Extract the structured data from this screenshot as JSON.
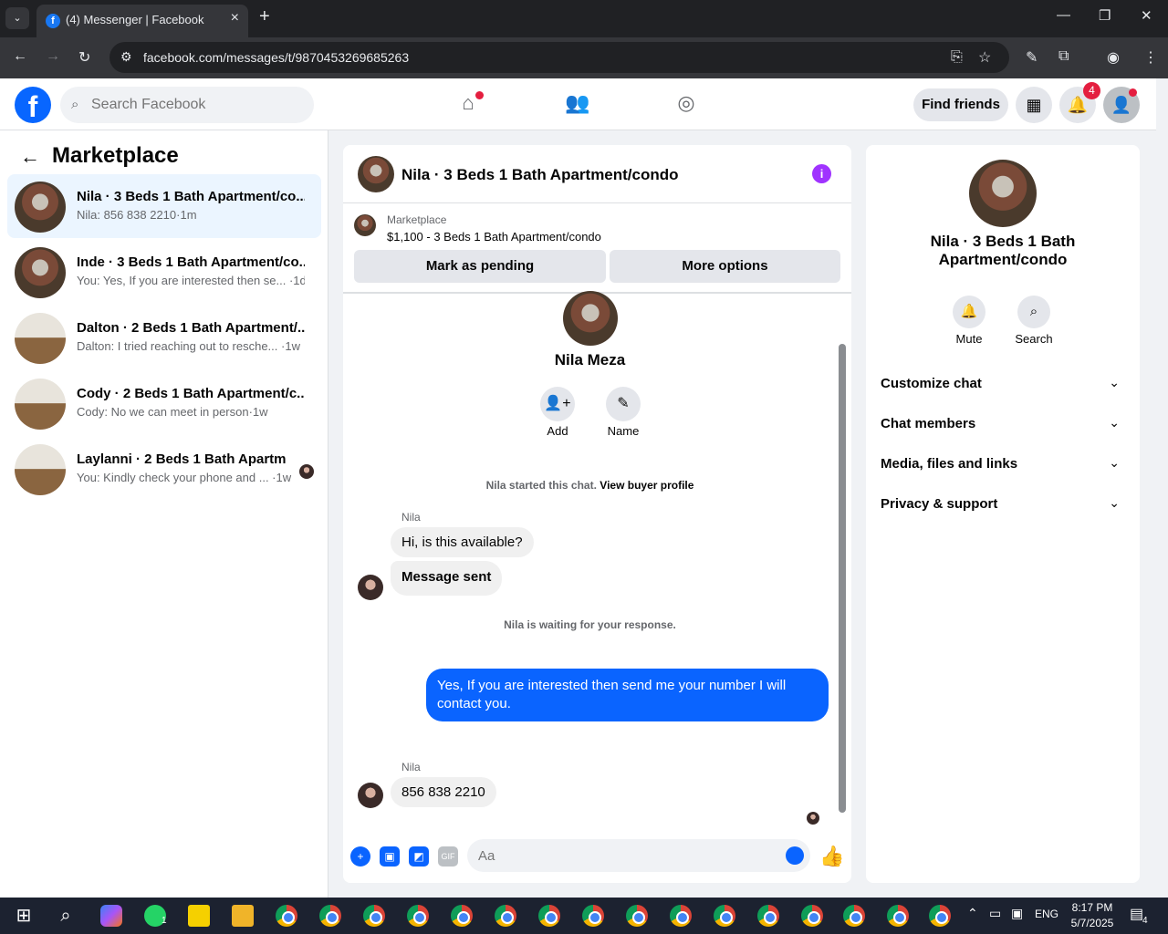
{
  "browser": {
    "tab_title": "(4) Messenger | Facebook",
    "url": "facebook.com/messages/t/9870453269685263"
  },
  "fb_header": {
    "search_placeholder": "Search Facebook",
    "find_friends": "Find friends",
    "notifications_count": "4"
  },
  "sidebar": {
    "title": "Marketplace",
    "conversations": [
      {
        "name": "Nila · 3 Beds 1 Bath Apartment/co...",
        "preview": "Nila: 856 838 2210·1m",
        "thumb": "house"
      },
      {
        "name": "Inde · 3 Beds 1 Bath Apartment/co...",
        "preview": "You: Yes, If you are interested then se... ·1d",
        "thumb": "house"
      },
      {
        "name": "Dalton · 2 Beds 1 Bath Apartment/...",
        "preview": "Dalton: I tried reaching out to resche... ·1w",
        "thumb": "room"
      },
      {
        "name": "Cody · 2 Beds 1 Bath Apartment/c...",
        "preview": "Cody: No we can meet in person·1w",
        "thumb": "room"
      },
      {
        "name": "Laylanni · 2 Beds 1 Bath Apartm...",
        "preview": "You: Kindly check your phone and ... ·1w",
        "thumb": "room"
      }
    ]
  },
  "chat": {
    "title": "Nila · 3 Beds 1 Bath Apartment/condo",
    "marketplace_label": "Marketplace",
    "listing": "$1,100 - 3 Beds 1 Bath Apartment/condo",
    "mark_pending": "Mark as pending",
    "more_options": "More options",
    "contact_name": "Nila Meza",
    "add_label": "Add",
    "name_label": "Name",
    "started_text": "Nila started this chat.",
    "view_profile": "View buyer profile",
    "sender1": "Nila",
    "msg1": "Hi, is this available?",
    "msg2": "Message sent",
    "waiting_text": "Nila is waiting for your response.",
    "my_msg": "Yes, If you are interested then send me your number I will contact you.",
    "sender2": "Nila",
    "msg3": "856 838 2210",
    "composer_placeholder": "Aa"
  },
  "right_panel": {
    "title": "Nila · 3 Beds 1 Bath Apartment/condo",
    "mute": "Mute",
    "search": "Search",
    "sections": [
      "Customize chat",
      "Chat members",
      "Media, files and links",
      "Privacy & support"
    ]
  },
  "taskbar": {
    "lang": "ENG",
    "time": "8:17 PM",
    "date": "5/7/2025",
    "notif_count": "4",
    "whatsapp_count": "1"
  },
  "colors": {
    "fb_blue": "#0866ff",
    "my_bubble": "#0a64ff",
    "info": "#a033ff",
    "badge": "#e41e3f"
  }
}
